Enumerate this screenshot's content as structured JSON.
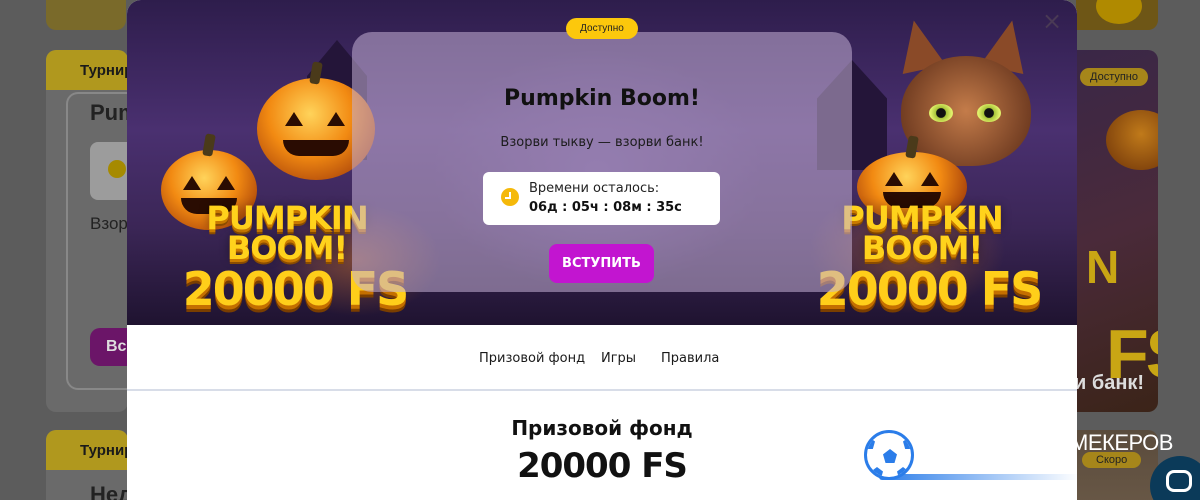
{
  "background": {
    "card1_tab": "Турнир",
    "card1_title": "Pump",
    "card1_text": "Взор",
    "card1_button": "Вс",
    "card2_tab": "Турнир",
    "card2_title": "Нед",
    "right_card": {
      "badge": "Доступно",
      "big_text_1": "N",
      "big_text_2": "FS",
      "tagline": "и банк!"
    },
    "right_card2": {
      "badge": "Скоро"
    },
    "bookmaker_text": "МЕКЕРОВ"
  },
  "modal": {
    "badge": "Доступно",
    "close_icon": "close-icon",
    "title": "Pumpkin Boom!",
    "subtitle": "Взорви тыкву — взорви банк!",
    "timer": {
      "label": "Времени осталось:",
      "value": "06д : 05ч : 08м : 35с",
      "icon": "clock-icon"
    },
    "join_button": "ВСТУПИТЬ",
    "promo_left": {
      "line1": "PUMPKIN",
      "line2": "BOOM!",
      "line3": "20000 FS"
    },
    "promo_right": {
      "line1": "PUMPKIN",
      "line2": "BOOM!",
      "line3": "20000 FS"
    },
    "tabs": [
      "Призовой фонд",
      "Игры",
      "Правила"
    ],
    "prize": {
      "label": "Призовой фонд",
      "value": "20000 FS"
    }
  },
  "colors": {
    "accent_button": "#c215d0",
    "badge_yellow": "#fcc80c",
    "promo_yellow": "#ffd21c",
    "ball_blue": "#2b7de9"
  }
}
